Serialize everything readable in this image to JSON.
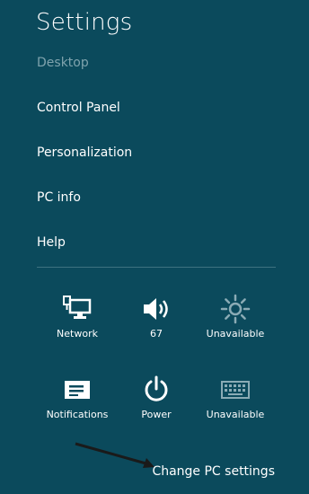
{
  "panel": {
    "title": "Settings"
  },
  "menu": {
    "items": [
      {
        "label": "Desktop",
        "dim": true
      },
      {
        "label": "Control Panel"
      },
      {
        "label": "Personalization"
      },
      {
        "label": "PC info"
      },
      {
        "label": "Help"
      }
    ]
  },
  "quick_settings": {
    "tiles": [
      {
        "label": "Network",
        "icon": "network-icon"
      },
      {
        "label": "67",
        "icon": "speaker-volume-icon"
      },
      {
        "label": "Unavailable",
        "icon": "brightness-icon"
      },
      {
        "label": "Notifications",
        "icon": "notifications-icon"
      },
      {
        "label": "Power",
        "icon": "power-icon"
      },
      {
        "label": "Unavailable",
        "icon": "keyboard-icon"
      }
    ]
  },
  "footer": {
    "change_pc_settings_label": "Change PC settings"
  },
  "colors": {
    "background": "#0b4a5c",
    "text": "#ffffff",
    "dim_text": "#7fa3ad",
    "annotation_arrow": "#1a1a1a"
  }
}
